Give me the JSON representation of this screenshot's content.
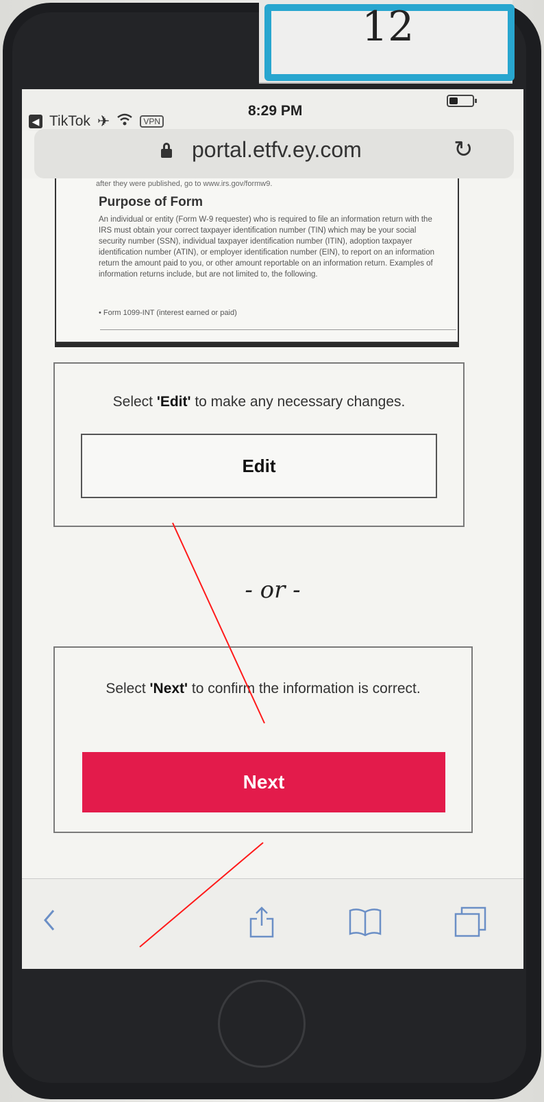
{
  "sticker": {
    "label": "12"
  },
  "status_bar": {
    "back_app": "TikTok",
    "vpn": "VPN",
    "time": "8:29 PM",
    "icons": [
      "airplane-icon",
      "wifi-icon",
      "battery-icon"
    ]
  },
  "browser": {
    "url": "portal.etfv.ey.com",
    "icons": [
      "lock-icon",
      "reload-icon"
    ]
  },
  "form_image": {
    "top_text": "after they were published, go to www.irs.gov/formw9.",
    "heading": "Purpose of Form",
    "body": "An individual or entity (Form W-9 requester) who is required to file an information return with the IRS must obtain your correct taxpayer identification number (TIN) which may be your social security number (SSN), individual taxpayer identification number (ITIN), adoption taxpayer identification number (ATIN), or employer identification number (EIN), to report on an information return the amount paid to you, or other amount reportable on an information return. Examples of information returns include, but are not limited to, the following.",
    "bullet": "• Form 1099-INT (interest earned or paid)"
  },
  "edit_section": {
    "prompt_prefix": "Select ",
    "prompt_bold": "'Edit'",
    "prompt_suffix": " to make any necessary changes.",
    "button_label": "Edit"
  },
  "separator": "- or -",
  "next_section": {
    "prompt_prefix": "Select ",
    "prompt_bold": "'Next'",
    "prompt_suffix": " to confirm the information is correct.",
    "button_label": "Next",
    "button_color": "#e31b4b"
  },
  "toolbar": {
    "icons": [
      "back-icon",
      "share-icon",
      "bookmarks-icon",
      "tabs-icon"
    ]
  }
}
